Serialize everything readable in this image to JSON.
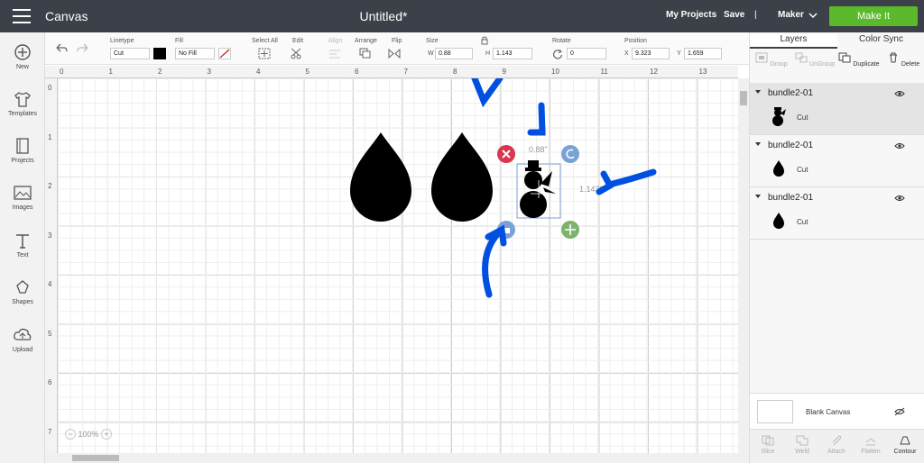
{
  "header": {
    "app_title": "Canvas",
    "doc_title": "Untitled*",
    "my_projects": "My Projects",
    "save": "Save",
    "separator": "|",
    "machine": "Maker",
    "make_it": "Make It"
  },
  "sidebar": [
    {
      "label": "New",
      "icon": "plus-circle-icon"
    },
    {
      "label": "Templates",
      "icon": "tshirt-icon"
    },
    {
      "label": "Projects",
      "icon": "book-icon"
    },
    {
      "label": "Images",
      "icon": "image-icon"
    },
    {
      "label": "Text",
      "icon": "text-icon"
    },
    {
      "label": "Shapes",
      "icon": "shapes-icon"
    },
    {
      "label": "Upload",
      "icon": "cloud-upload-icon"
    }
  ],
  "toolbar": {
    "linetype_label": "Linetype",
    "linetype_value": "Cut",
    "fill_label": "Fill",
    "fill_value": "No Fill",
    "select_all_label": "Select All",
    "edit_label": "Edit",
    "align_label": "Align",
    "arrange_label": "Arrange",
    "flip_label": "Flip",
    "size_label": "Size",
    "w_label": "W",
    "w_value": "0.88",
    "h_label": "H",
    "h_value": "1.143",
    "rotate_label": "Rotate",
    "rotate_value": "0",
    "position_label": "Position",
    "x_label": "X",
    "x_value": "9.323",
    "y_label": "Y",
    "y_value": "1.659"
  },
  "ruler": {
    "top": [
      "0",
      "1",
      "2",
      "3",
      "4",
      "5",
      "6",
      "7",
      "8",
      "9",
      "10",
      "11",
      "12",
      "13"
    ],
    "left": [
      "0",
      "1",
      "2",
      "3",
      "4",
      "5",
      "6",
      "7"
    ]
  },
  "canvas": {
    "width_readout": "0.88\"",
    "height_readout": "1.143\"",
    "zoom": "100%"
  },
  "panel": {
    "tabs": [
      "Layers",
      "Color Sync"
    ],
    "actions": [
      {
        "label": "Group",
        "enabled": false
      },
      {
        "label": "UnGroup",
        "enabled": false
      },
      {
        "label": "Duplicate",
        "enabled": true
      },
      {
        "label": "Delete",
        "enabled": true
      }
    ],
    "layers": [
      {
        "name": "bundle2-01",
        "operation": "Cut",
        "thumb": "snowman",
        "selected": true
      },
      {
        "name": "bundle2-01",
        "operation": "Cut",
        "thumb": "teardrop",
        "selected": false
      },
      {
        "name": "bundle2-01",
        "operation": "Cut",
        "thumb": "teardrop",
        "selected": false
      }
    ],
    "blank_canvas": "Blank Canvas",
    "bottom_actions": [
      {
        "label": "Slice",
        "enabled": false
      },
      {
        "label": "Weld",
        "enabled": false
      },
      {
        "label": "Attach",
        "enabled": false
      },
      {
        "label": "Flatten",
        "enabled": false
      },
      {
        "label": "Contour",
        "enabled": true
      }
    ]
  },
  "colors": {
    "topbar": "#3c4048",
    "make_it": "#5aba2c",
    "annotation_arrows": "#0050e0",
    "delete_handle": "#d9364f",
    "scale_handle": "#7db36d",
    "rotate_handle": "#7aa2d6"
  }
}
